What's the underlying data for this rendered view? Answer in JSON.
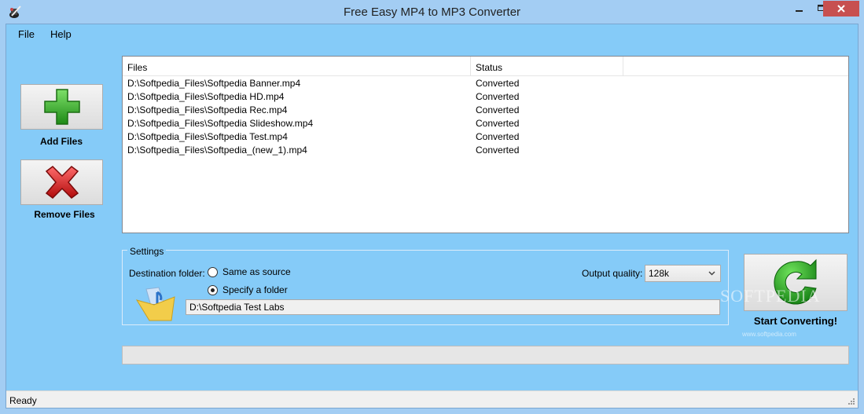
{
  "window": {
    "title": "Free Easy MP4 to MP3 Converter",
    "icon": "app-wizard-icon",
    "controls": {
      "minimize": "minimize-icon",
      "maximize": "maximize-icon",
      "close": "close-icon"
    }
  },
  "menu": {
    "items": [
      {
        "label": "File"
      },
      {
        "label": "Help"
      }
    ]
  },
  "sidebar": {
    "add_label": "Add Files",
    "add_icon": "plus-icon",
    "remove_label": "Remove Files",
    "remove_icon": "x-icon"
  },
  "file_list": {
    "columns": [
      "Files",
      "Status"
    ],
    "rows": [
      {
        "file": "D:\\Softpedia_Files\\Softpedia Banner.mp4",
        "status": "Converted"
      },
      {
        "file": "D:\\Softpedia_Files\\Softpedia HD.mp4",
        "status": "Converted"
      },
      {
        "file": "D:\\Softpedia_Files\\Softpedia Rec.mp4",
        "status": "Converted"
      },
      {
        "file": "D:\\Softpedia_Files\\Softpedia Slideshow.mp4",
        "status": "Converted"
      },
      {
        "file": "D:\\Softpedia_Files\\Softpedia Test.mp4",
        "status": "Converted"
      },
      {
        "file": "D:\\Softpedia_Files\\Softpedia_(new_1).mp4",
        "status": "Converted"
      }
    ]
  },
  "settings": {
    "legend": "Settings",
    "destination_label": "Destination folder:",
    "option_same": "Same as source",
    "option_specify": "Specify a folder",
    "selected_option": "Specify a folder",
    "folder_path": "D:\\Softpedia Test Labs",
    "quality_label": "Output quality:",
    "quality_value": "128k"
  },
  "convert": {
    "label": "Start Converting!",
    "icon": "refresh-arrow-icon"
  },
  "progress": {
    "value_percent": 0
  },
  "status": {
    "text": "Ready"
  },
  "watermark": {
    "text": "SOFTPEDIA",
    "url": "www.softpedia.com"
  }
}
